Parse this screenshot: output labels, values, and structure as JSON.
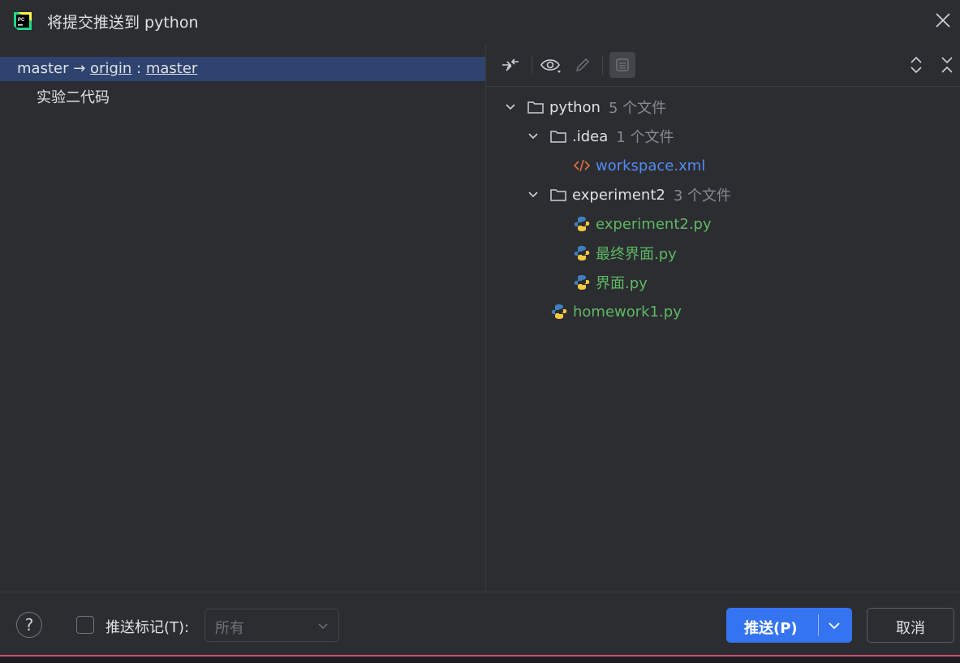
{
  "window": {
    "title": "将提交推送到 python",
    "close_icon": "close-icon"
  },
  "left": {
    "branch": {
      "local": "master",
      "arrow": "→",
      "remote": "origin",
      "colon": ":",
      "target": "master"
    },
    "commits": [
      "实验二代码"
    ]
  },
  "toolbar": {
    "icons": [
      "merge-arrows-icon",
      "eye-icon",
      "pencil-icon",
      "document-icon",
      "expand-all-icon",
      "collapse-all-icon"
    ]
  },
  "tree": {
    "root": {
      "name": "python",
      "count": "5 个文件"
    },
    "idea": {
      "name": ".idea",
      "count": "1 个文件"
    },
    "workspace": {
      "name": "workspace.xml"
    },
    "experiment2": {
      "name": "experiment2",
      "count": "3 个文件"
    },
    "files": [
      "experiment2.py",
      "最终界面.py",
      "界面.py"
    ],
    "homework": {
      "name": "homework1.py"
    }
  },
  "bottom": {
    "help": "?",
    "push_tags_label": "推送标记(T):",
    "tags_select_value": "所有",
    "push_button": "推送(P)",
    "cancel_button": "取消"
  },
  "colors": {
    "background": "#2b2d30",
    "selection": "#2e436e",
    "primary_button": "#3574f0",
    "modified_file": "#548af7",
    "added_file": "#5fb865"
  }
}
